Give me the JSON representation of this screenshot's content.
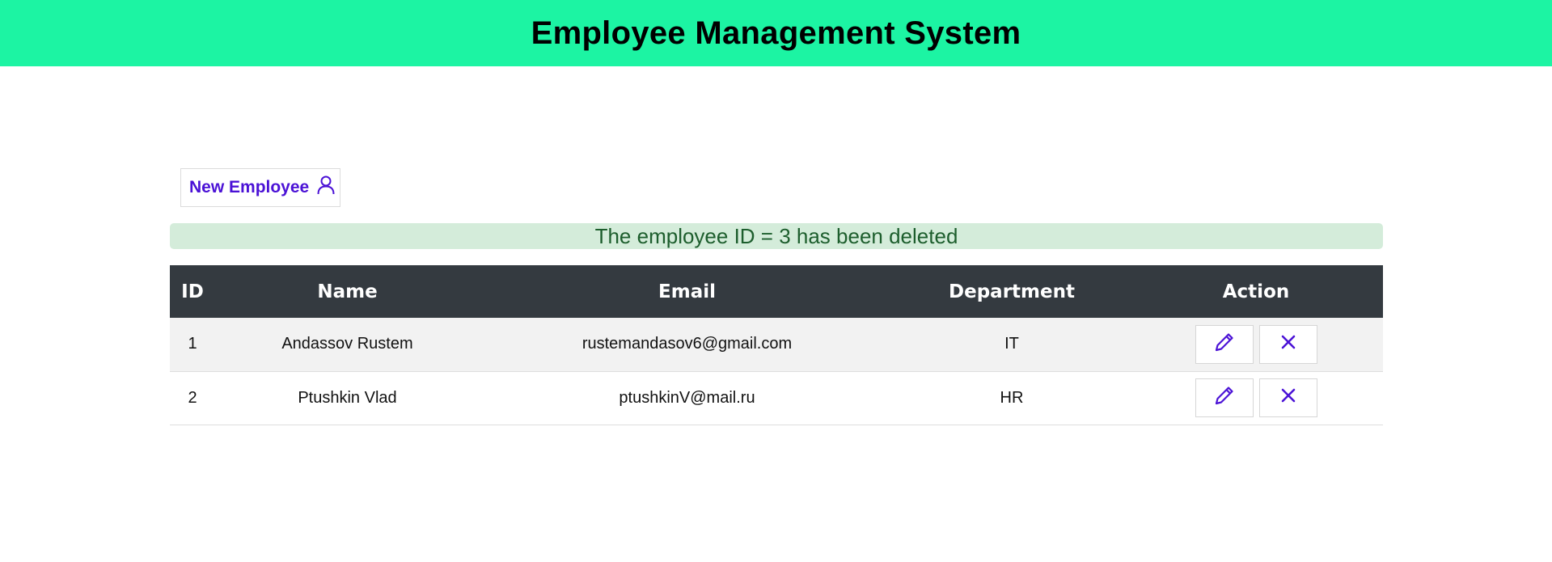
{
  "header": {
    "title": "Employee Management System"
  },
  "toolbar": {
    "new_employee_label": "New Employee"
  },
  "alert": {
    "message": "The employee ID = 3 has been deleted"
  },
  "table": {
    "columns": [
      "ID",
      "Name",
      "Email",
      "Department",
      "Action"
    ],
    "rows": [
      {
        "id": "1",
        "name": "Andassov Rustem",
        "email": "rustemandasov6@gmail.com",
        "department": "IT"
      },
      {
        "id": "2",
        "name": "Ptushkin Vlad",
        "email": "ptushkinV@mail.ru",
        "department": "HR"
      }
    ]
  },
  "icons": {
    "new_employee": "user-icon",
    "edit": "pencil-icon",
    "delete": "x-icon"
  },
  "colors": {
    "header_bg": "#1cf4a3",
    "accent": "#4b12d6",
    "alert_bg": "#d4ecda",
    "alert_text": "#1d5e2d",
    "table_header_bg": "#343a40"
  }
}
